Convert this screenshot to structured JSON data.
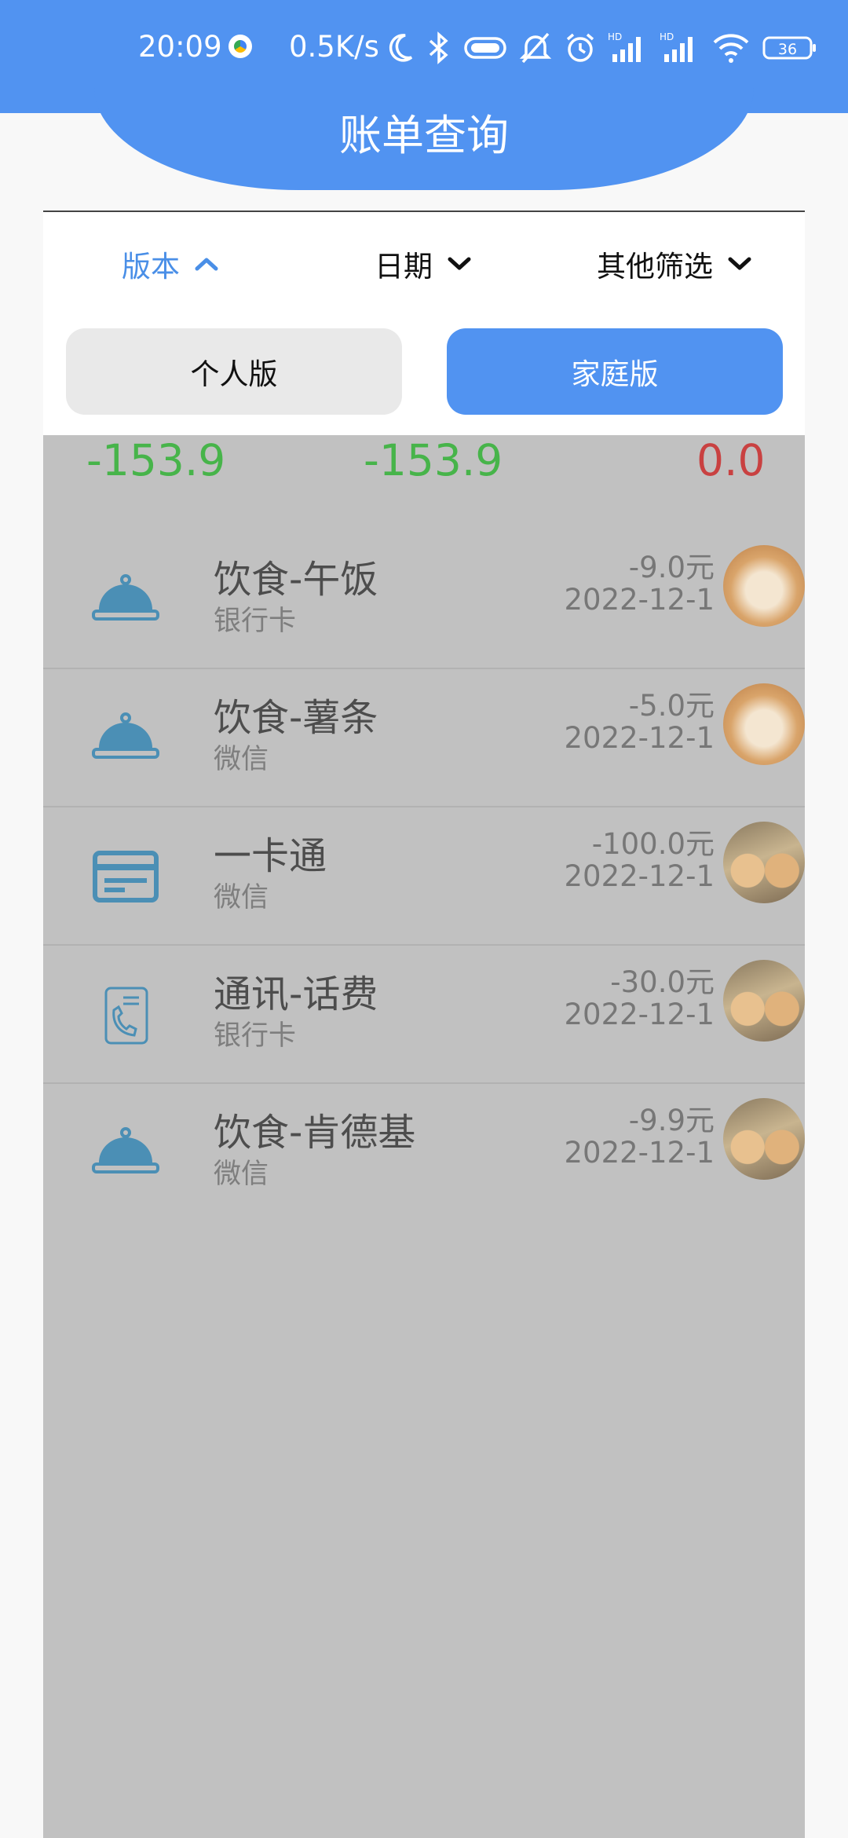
{
  "status_bar": {
    "time": "20:09",
    "net_speed": "0.5K/s",
    "battery": "36",
    "icons": [
      "app-badge-icon",
      "moon-icon",
      "bluetooth-icon",
      "capsule-icon",
      "silent-icon",
      "alarm-icon",
      "signal-hd-icon",
      "signal-hd-icon",
      "wifi-icon",
      "battery-icon"
    ],
    "signal_label": "HD"
  },
  "header": {
    "title": "账单查询"
  },
  "filters": {
    "version_label": "版本",
    "date_label": "日期",
    "other_label": "其他筛选",
    "active_color": "#4a8fe7"
  },
  "segment": {
    "personal_label": "个人版",
    "family_label": "家庭版",
    "selected": "家庭版"
  },
  "summary": {
    "values": [
      "-153.9",
      "-153.9",
      "0.0"
    ]
  },
  "bills": [
    {
      "icon": "food-cloche-icon",
      "title": "饮食-午饭",
      "method": "银行卡",
      "amount": "-9.0元",
      "date": "2022-12-1",
      "avatar": "dog-single"
    },
    {
      "icon": "food-cloche-icon",
      "title": "饮食-薯条",
      "method": "微信",
      "amount": "-5.0元",
      "date": "2022-12-1",
      "avatar": "dog-single"
    },
    {
      "icon": "card-icon",
      "title": "一卡通",
      "method": "微信",
      "amount": "-100.0元",
      "date": "2022-12-1",
      "avatar": "dog-pair"
    },
    {
      "icon": "phone-bill-icon",
      "title": "通讯-话费",
      "method": "银行卡",
      "amount": "-30.0元",
      "date": "2022-12-1",
      "avatar": "dog-pair"
    },
    {
      "icon": "food-cloche-icon",
      "title": "饮食-肯德基",
      "method": "微信",
      "amount": "-9.9元",
      "date": "2022-12-1",
      "avatar": "dog-pair"
    }
  ],
  "colors": {
    "primary": "#5193f1",
    "income_green": "#47b44a",
    "expense_red": "#c94141",
    "overlay_gray": "#c1c1c1"
  }
}
